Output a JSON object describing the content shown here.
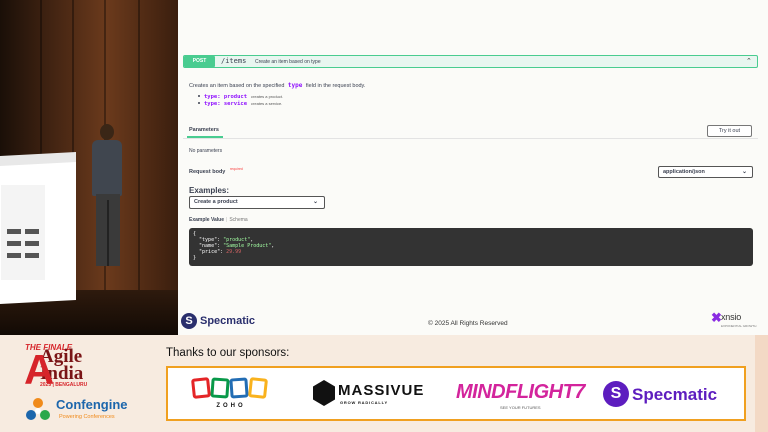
{
  "endpoint": {
    "method": "POST",
    "path": "/items",
    "summary": "Create an item based on type",
    "chevron_icon": "chevron-up-icon"
  },
  "description": {
    "prefix": "Creates an item based on the specified",
    "code": "type",
    "suffix": "field in the request body.",
    "bullets": [
      {
        "code": "type: product",
        "note": "creates a product."
      },
      {
        "code": "type: service",
        "note": "creates a service."
      }
    ]
  },
  "parameters": {
    "heading": "Parameters",
    "try_button": "Try it out",
    "empty_text": "No parameters"
  },
  "request_body": {
    "label": "Request body",
    "required": "required",
    "content_type": "application/json"
  },
  "examples": {
    "label": "Examples:",
    "selected": "Create a product",
    "tab_example": "Example Value",
    "tab_schema": "Schema",
    "code_lines": [
      "{",
      "  \"type\": \"product\",",
      "  \"name\": \"Sample Product\",",
      "  \"price\": 29.99",
      "}"
    ]
  },
  "footer": {
    "brand": "Specmatic",
    "copyright": "© 2025 All Rights Reserved",
    "partner": "xnsio",
    "partner_tag": "EXPONENTIAL GROWTH"
  },
  "event": {
    "finale": "THE FINALE",
    "name_line1": "Agile",
    "name_line2": "India",
    "subline": "2025 | BENGALURU",
    "confengine": "Confengine",
    "confengine_tag": "Powering Conferences",
    "thanks": "Thanks to our sponsors:",
    "sponsors": {
      "zoho": "ZOHO",
      "massivue": "MASSIVUE",
      "massivue_tag": "GROW RADICALLY",
      "mindflight": "MINDFLIGHT7",
      "mindflight_tag": "SEE YOUR FUTURES",
      "specmatic": "Specmatic"
    }
  },
  "colors": {
    "post_green": "#49cc90",
    "code_bg": "#333333",
    "specmatic_purple": "#5d1dbf",
    "agile_red": "#d6242a"
  }
}
